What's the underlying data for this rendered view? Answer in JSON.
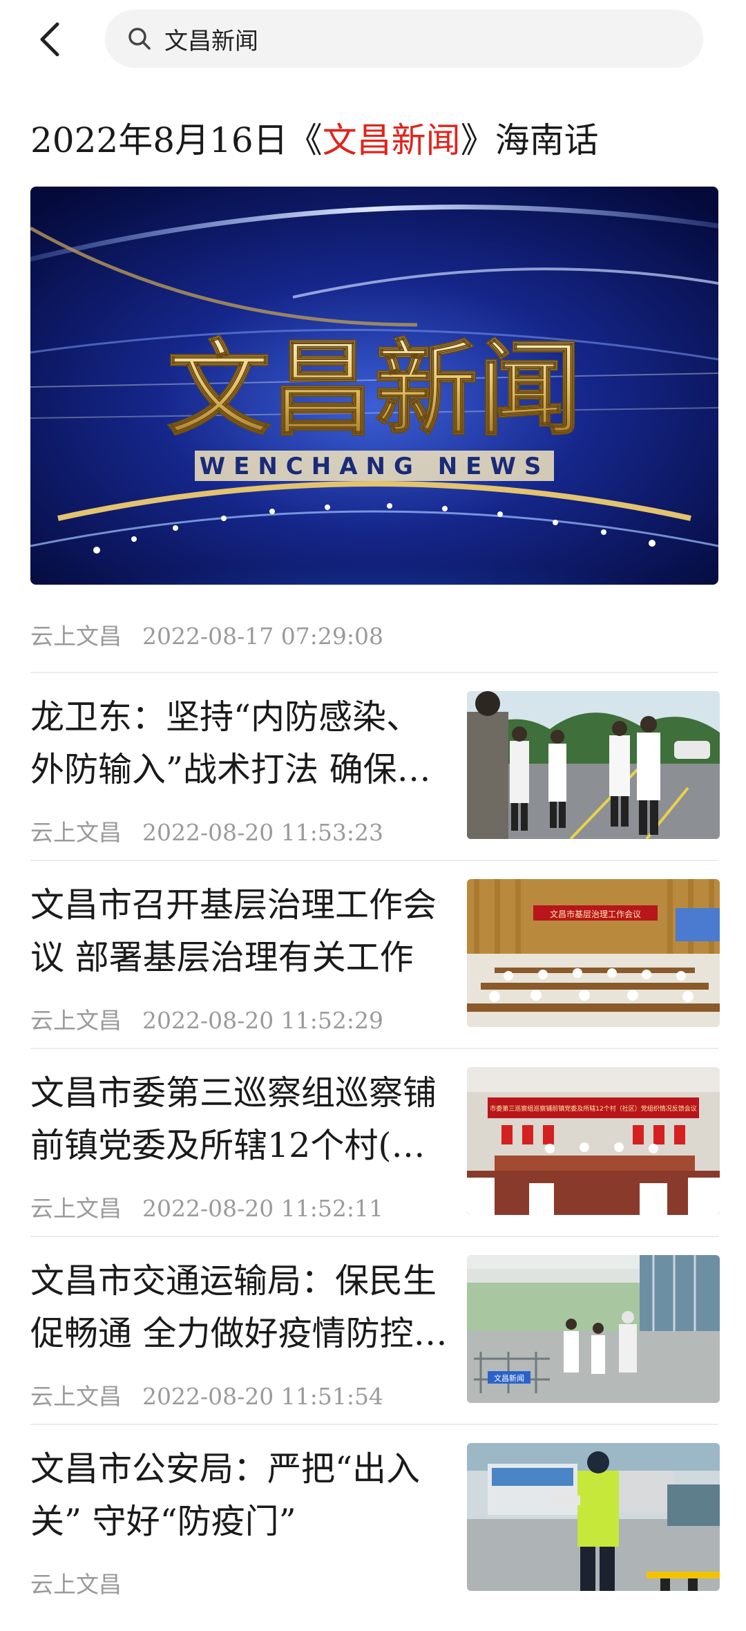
{
  "search": {
    "query": "文昌新闻"
  },
  "featured": {
    "title_prefix": "2022年8月16日《",
    "title_highlight": "文昌新闻",
    "title_suffix": "》海南话",
    "banner_title": "文昌新闻",
    "banner_subtitle": "WENCHANG NEWS",
    "source": "云上文昌",
    "time": "2022-08-17 07:29:08"
  },
  "news": [
    {
      "title": "龙卫东：坚持“内防感染、外防输入”战术打法 确保…",
      "source": "云上文昌",
      "time": "2022-08-20 11:53:23"
    },
    {
      "title": "文昌市召开基层治理工作会议 部署基层治理有关工作",
      "source": "云上文昌",
      "time": "2022-08-20 11:52:29"
    },
    {
      "title": "文昌市委第三巡察组巡察铺前镇党委及所辖12个村(…",
      "source": "云上文昌",
      "time": "2022-08-20 11:52:11"
    },
    {
      "title": "文昌市交通运输局：保民生促畅通 全力做好疫情防控…",
      "source": "云上文昌",
      "time": "2022-08-20 11:51:54"
    },
    {
      "title": "文昌市公安局：严把“出入关” 守好“防疫门”",
      "source": "云上文昌",
      "time": ""
    }
  ],
  "thumbs": {
    "meeting_banner_1": "文昌市基层治理工作会议",
    "meeting_banner_2": "市委第三巡察组巡察铺前镇党委及所辖12个村（社区）党组织情况反馈会议",
    "sign_label": "文昌新闻"
  },
  "colors": {
    "accent": "#e0241c",
    "meta": "#9a9a9a",
    "search_bg": "#f3f3f3"
  }
}
